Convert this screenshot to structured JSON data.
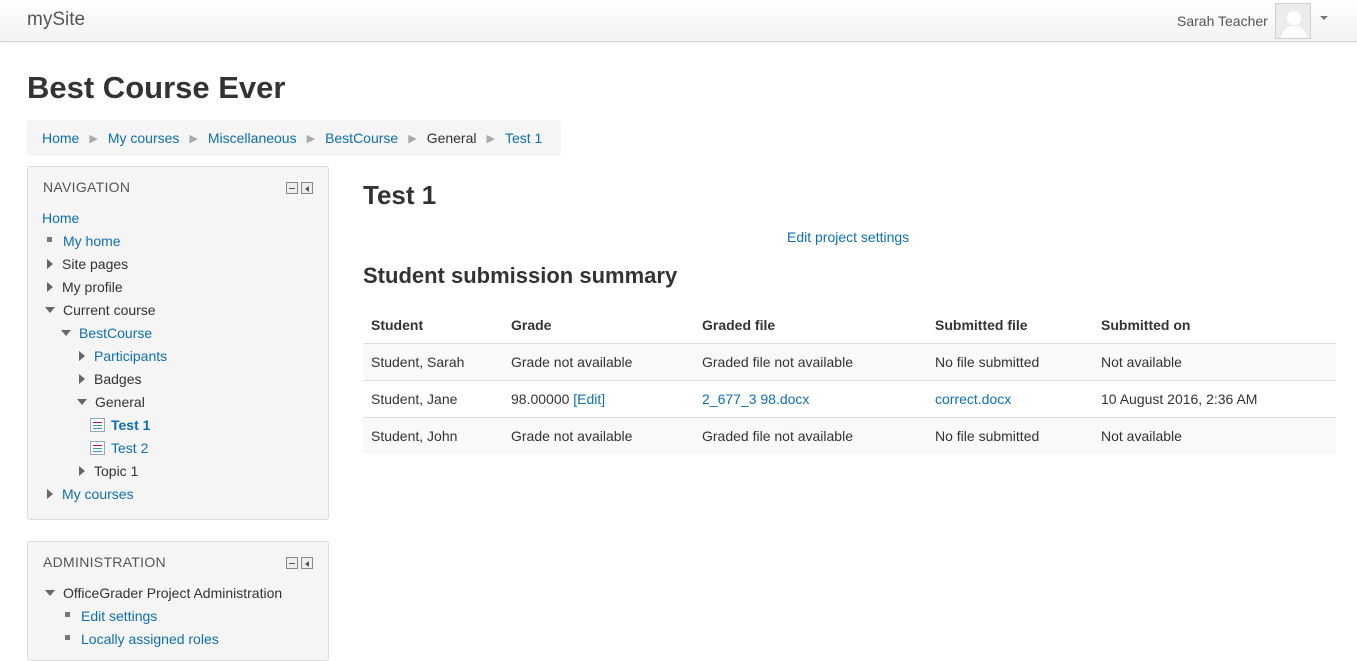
{
  "navbar": {
    "brand": "mySite",
    "user_name": "Sarah Teacher"
  },
  "page": {
    "course_title": "Best Course Ever"
  },
  "breadcrumb": [
    {
      "label": "Home",
      "link": true
    },
    {
      "label": "My courses",
      "link": true
    },
    {
      "label": "Miscellaneous",
      "link": true
    },
    {
      "label": "BestCourse",
      "link": true
    },
    {
      "label": "General",
      "link": false
    },
    {
      "label": "Test 1",
      "link": true
    }
  ],
  "navigation": {
    "title": "NAVIGATION",
    "home": "Home",
    "my_home": "My home",
    "site_pages": "Site pages",
    "my_profile": "My profile",
    "current_course": "Current course",
    "best_course": "BestCourse",
    "participants": "Participants",
    "badges": "Badges",
    "general": "General",
    "test1": "Test 1",
    "test2": "Test 2",
    "topic1": "Topic 1",
    "my_courses": "My courses"
  },
  "administration": {
    "title": "ADMINISTRATION",
    "project_admin": "OfficeGrader Project Administration",
    "edit_settings": "Edit settings",
    "local_roles": "Locally assigned roles"
  },
  "main": {
    "title": "Test 1",
    "edit_link": "Edit project settings",
    "summary_title": "Student submission summary",
    "table": {
      "headers": [
        "Student",
        "Grade",
        "Graded file",
        "Submitted file",
        "Submitted on"
      ],
      "rows": [
        {
          "student": "Student, Sarah",
          "grade": "Grade not available",
          "grade_edit": "",
          "graded_file": "Graded file not available",
          "graded_file_link": false,
          "submitted_file": "No file submitted",
          "submitted_file_link": false,
          "submitted_on": "Not available"
        },
        {
          "student": "Student, Jane",
          "grade": "98.00000",
          "grade_edit": "[Edit]",
          "graded_file": "2_677_3 98.docx",
          "graded_file_link": true,
          "submitted_file": "correct.docx",
          "submitted_file_link": true,
          "submitted_on": "10 August 2016, 2:36 AM"
        },
        {
          "student": "Student, John",
          "grade": "Grade not available",
          "grade_edit": "",
          "graded_file": "Graded file not available",
          "graded_file_link": false,
          "submitted_file": "No file submitted",
          "submitted_file_link": false,
          "submitted_on": "Not available"
        }
      ]
    }
  }
}
